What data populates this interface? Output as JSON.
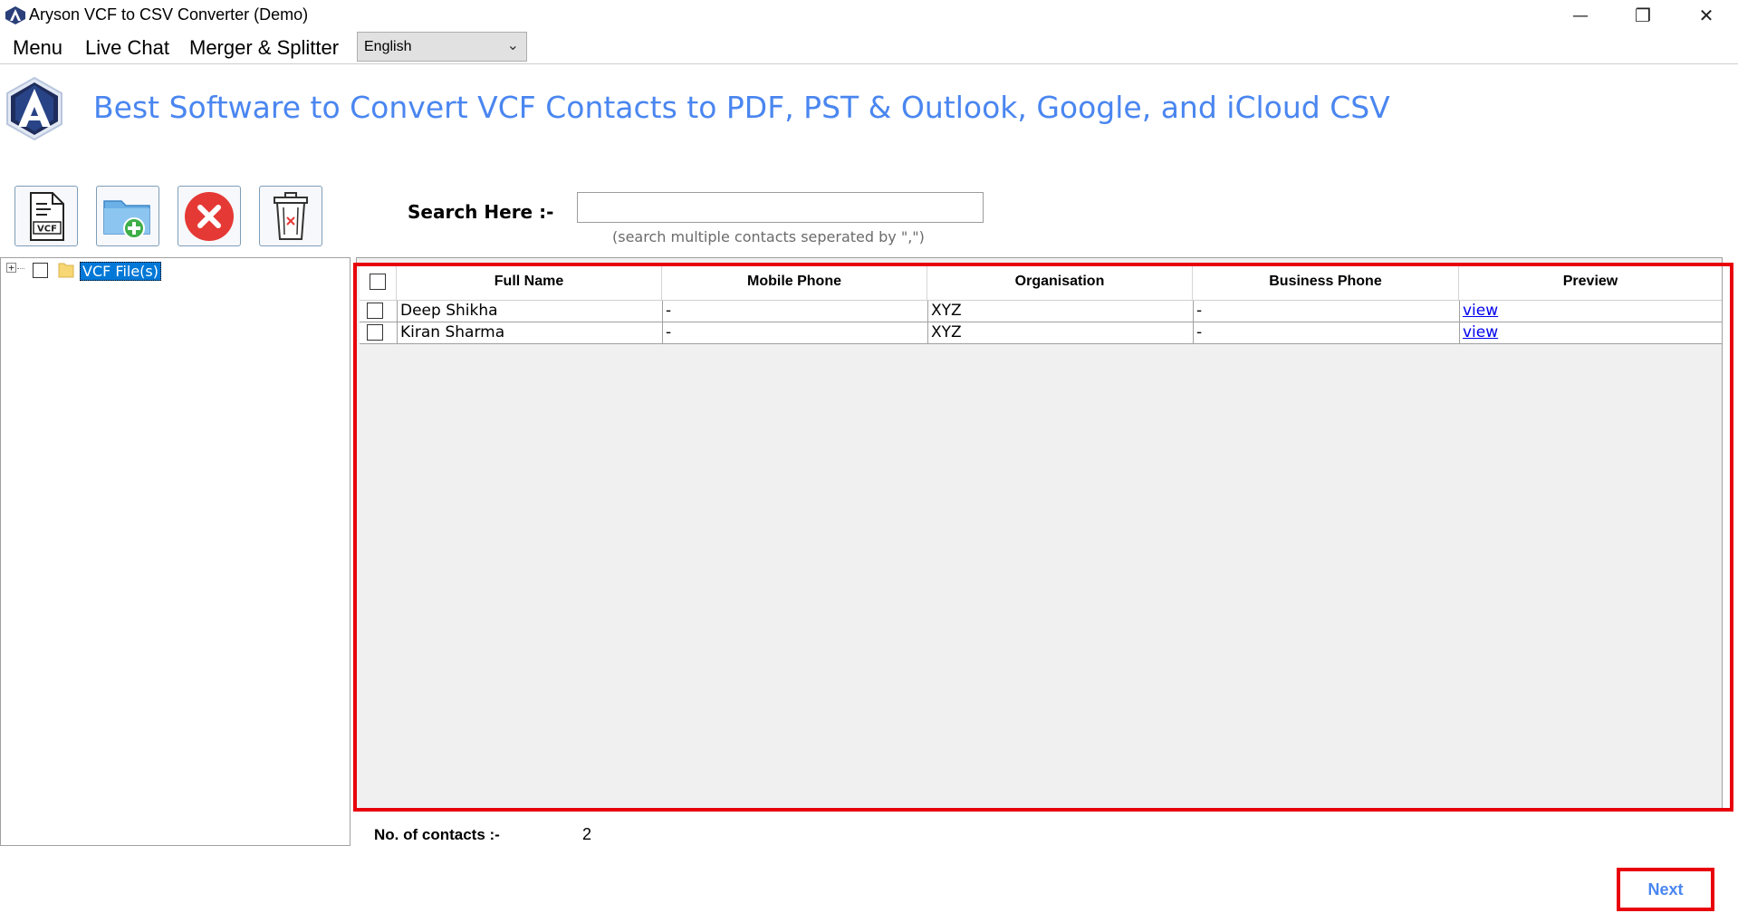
{
  "window": {
    "title": "Aryson VCF to CSV Converter (Demo)",
    "minimize_glyph": "—",
    "restore_glyph": "❐",
    "close_glyph": "✕"
  },
  "menubar": {
    "items": [
      "Menu",
      "Live Chat",
      "Merger & Splitter"
    ],
    "language": {
      "selected": "English"
    }
  },
  "header": {
    "headline": "Best Software to Convert VCF Contacts to PDF, PST & Outlook, Google, and iCloud CSV",
    "accent_color": "#4a86f0"
  },
  "toolbar": {
    "icons": [
      "vcf-file-icon",
      "add-folder-icon",
      "remove-icon",
      "delete-trash-icon"
    ],
    "vcf_icon_text": "VCF"
  },
  "search": {
    "label": "Search Here  :-",
    "value": "",
    "placeholder": "",
    "hint": "(search multiple contacts seperated by \",\")"
  },
  "tree": {
    "root_label": "VCF File(s)",
    "expander": "+"
  },
  "grid": {
    "columns": [
      "Full Name",
      "Mobile Phone",
      "Organisation",
      "Business Phone",
      "Preview"
    ],
    "rows": [
      {
        "full_name": "Deep Shikha",
        "mobile_phone": "-",
        "organisation": "XYZ",
        "business_phone": "-",
        "preview": "view"
      },
      {
        "full_name": "Kiran Sharma",
        "mobile_phone": "-",
        "organisation": "XYZ",
        "business_phone": "-",
        "preview": "view"
      }
    ],
    "highlight_color": "#e8000b"
  },
  "footer": {
    "count_label": "No. of contacts :-",
    "count_value": "2",
    "next_label": "Next"
  }
}
